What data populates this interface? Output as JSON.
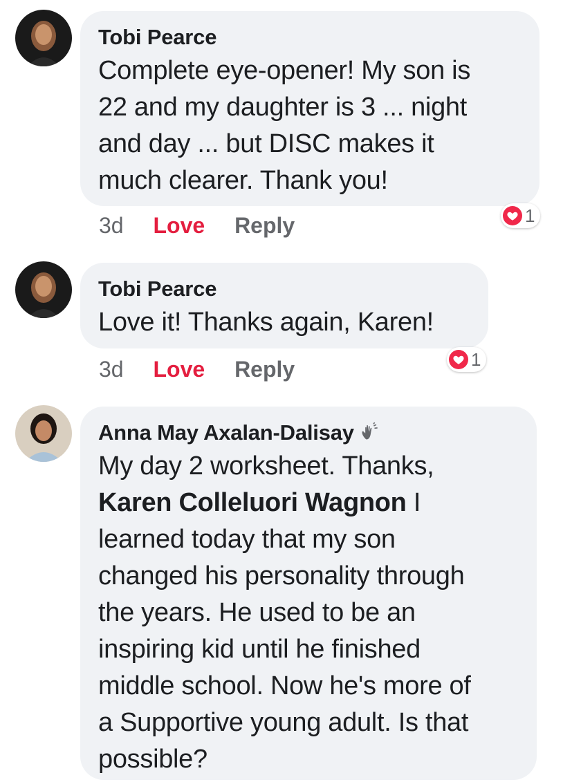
{
  "comments": [
    {
      "author": "Tobi Pearce",
      "lines": [
        "Complete eye-opener! My son is",
        "22 and my daughter is 3 ... night",
        "and day ... but DISC makes it",
        "much clearer.  Thank you!"
      ],
      "timestamp": "3d",
      "love_label": "Love",
      "reply_label": "Reply",
      "reaction_count": "1"
    },
    {
      "author": "Tobi Pearce",
      "lines": [
        "Love it! Thanks again, Karen!"
      ],
      "timestamp": "3d",
      "love_label": "Love",
      "reply_label": "Reply",
      "reaction_count": "1"
    },
    {
      "author": "Anna May Axalan-Dalisay",
      "line1": "My day 2 worksheet. Thanks,",
      "mention": "Karen Colleluori Wagnon",
      "mention_suffix": " I",
      "lines": [
        "learned today that my son",
        "changed his personality through",
        "the years. He used to be an",
        "inspiring kid until he finished",
        "middle school. Now he's more of",
        "a Supportive young adult. Is that",
        "possible?"
      ]
    }
  ],
  "icons": {
    "reaction": "heart-icon",
    "badge": "wave-icon"
  },
  "colors": {
    "love": "#e41e3f",
    "bubble": "#f0f2f5",
    "meta": "#65676b"
  }
}
